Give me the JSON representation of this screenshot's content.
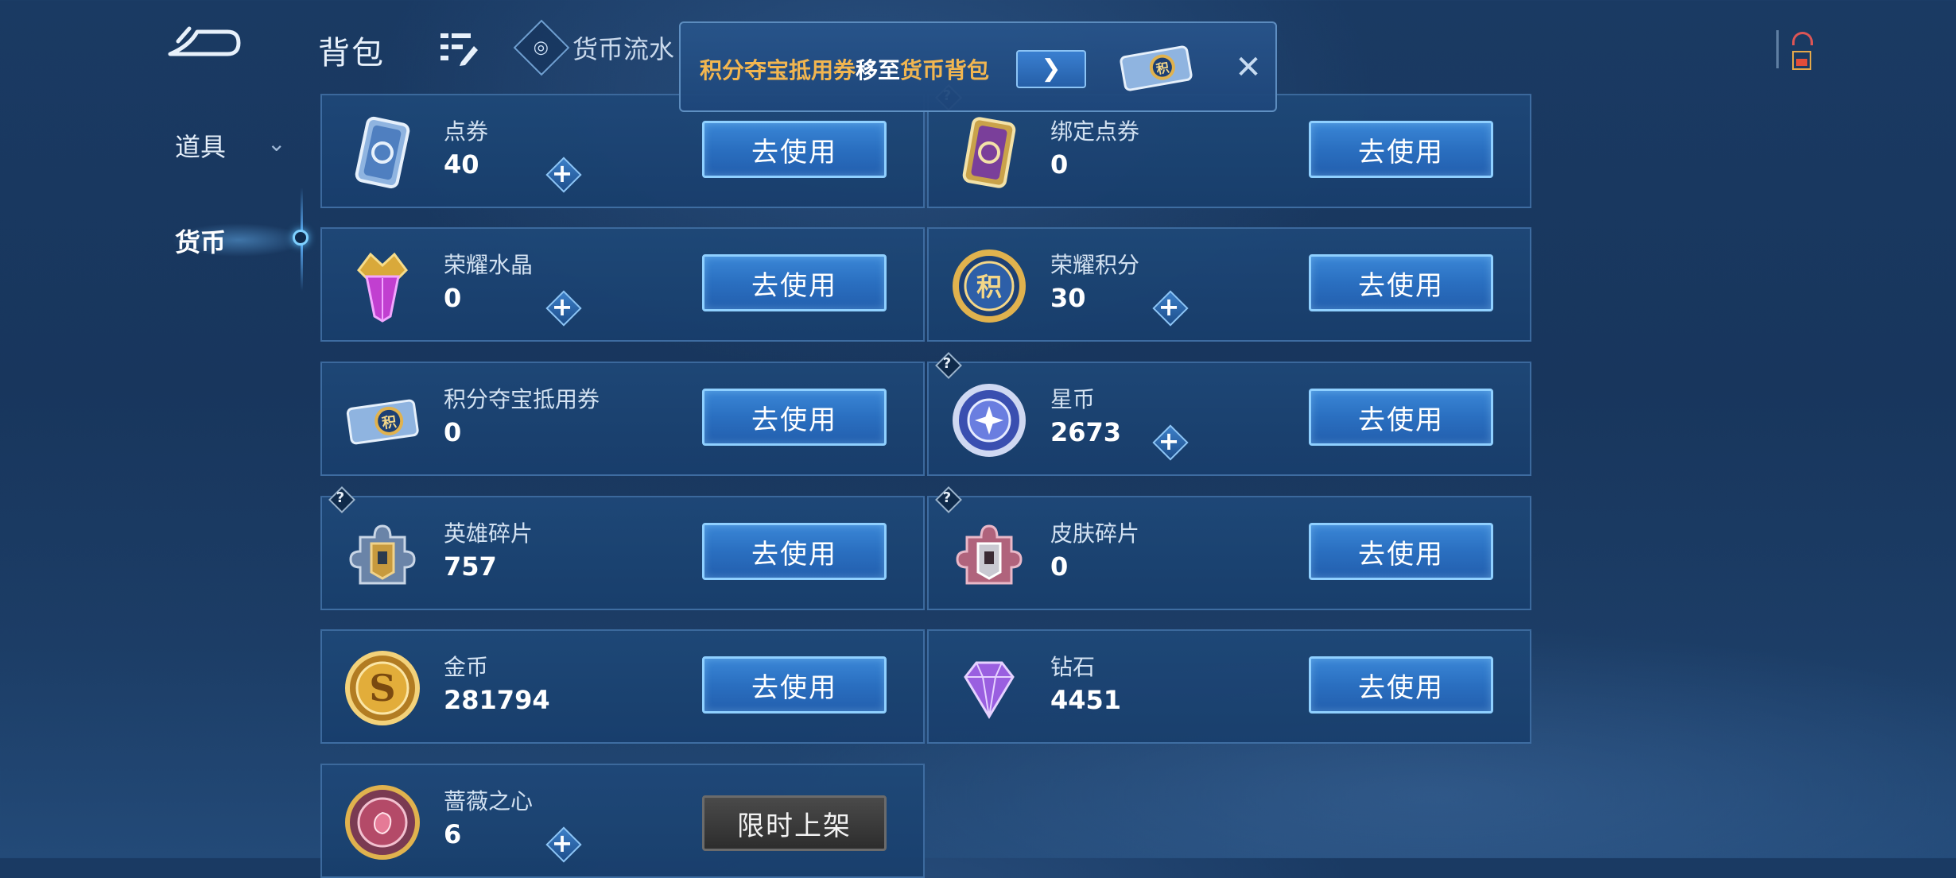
{
  "header": {
    "title": "背包",
    "flow_tab_label": "货币流水",
    "flow_icon_glyph": "◎"
  },
  "sidebar": {
    "items": [
      {
        "label": "道具",
        "chevron": "⌄"
      },
      {
        "label": "货币"
      }
    ]
  },
  "toast": {
    "item_name": "积分夺宝抵用券",
    "move_text": "移至",
    "target": "货币背包",
    "arrow_glyph": "❯",
    "close_glyph": "✕"
  },
  "currencies": [
    {
      "name": "点券",
      "count": "40",
      "button": "去使用",
      "has_plus": true,
      "icon": "ticket-icon"
    },
    {
      "name": "绑定点券",
      "count": "0",
      "button": "去使用",
      "has_help": true,
      "icon": "bound-ticket-icon"
    },
    {
      "name": "荣耀水晶",
      "count": "0",
      "button": "去使用",
      "has_plus": true,
      "icon": "glory-crystal-icon"
    },
    {
      "name": "荣耀积分",
      "count": "30",
      "button": "去使用",
      "has_plus": true,
      "icon": "glory-points-icon"
    },
    {
      "name": "积分夺宝抵用券",
      "count": "0",
      "button": "去使用",
      "icon": "voucher-icon"
    },
    {
      "name": "星币",
      "count": "2673",
      "button": "去使用",
      "has_plus": true,
      "has_help": true,
      "icon": "star-coin-icon"
    },
    {
      "name": "英雄碎片",
      "count": "757",
      "button": "去使用",
      "has_help": true,
      "icon": "hero-fragment-icon"
    },
    {
      "name": "皮肤碎片",
      "count": "0",
      "button": "去使用",
      "has_help": true,
      "icon": "skin-fragment-icon"
    },
    {
      "name": "金币",
      "count": "281794",
      "button": "去使用",
      "icon": "gold-coin-icon"
    },
    {
      "name": "钻石",
      "count": "4451",
      "button": "去使用",
      "icon": "diamond-icon"
    },
    {
      "name": "蔷薇之心",
      "count": "6",
      "button": "限时上架",
      "has_plus": true,
      "icon": "rose-heart-icon"
    }
  ],
  "plus_glyph": "+",
  "help_glyph": "?",
  "colors": {
    "accent_blue": "#2a6fc0",
    "button_border": "#8fd0ff",
    "toast_gold": "#f2b650"
  }
}
